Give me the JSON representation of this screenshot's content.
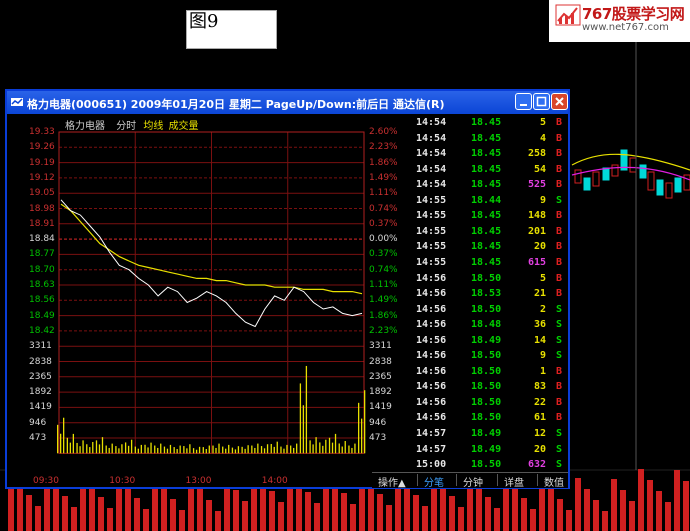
{
  "figure_label": "图9",
  "brand": {
    "name": "767股票学习网",
    "url": "www.net767.com"
  },
  "window": {
    "title": "格力电器(000651)  2009年01月20日  星期二  PageUp/Down:前后日  通达信(R)"
  },
  "quote": {
    "stock": "格力电器",
    "time_label": "分时",
    "avg_label": "均线",
    "vol_label": "成交量"
  },
  "left_ticks": [
    "19.33",
    "19.26",
    "19.19",
    "19.12",
    "19.05",
    "18.98",
    "18.91",
    "18.84",
    "18.77",
    "18.70",
    "18.63",
    "18.56",
    "18.49",
    "18.42",
    "3311",
    "2838",
    "2365",
    "1892",
    "1419",
    "946",
    "473"
  ],
  "right_ticks": [
    "2.60%",
    "2.23%",
    "1.86%",
    "1.49%",
    "1.11%",
    "0.74%",
    "0.37%",
    "0.00%",
    "0.37%",
    "0.74%",
    "1.11%",
    "1.49%",
    "1.86%",
    "2.23%",
    "3311",
    "2838",
    "2365",
    "1892",
    "1419",
    "946",
    "473"
  ],
  "x_ticks": [
    "09:30",
    "10:30",
    "13:00",
    "14:00"
  ],
  "trades": [
    {
      "time": "14:54",
      "price": "18.45",
      "vol": "5",
      "dir": "B"
    },
    {
      "time": "14:54",
      "price": "18.45",
      "vol": "4",
      "dir": "B"
    },
    {
      "time": "14:54",
      "price": "18.45",
      "vol": "258",
      "dir": "B"
    },
    {
      "time": "14:54",
      "price": "18.45",
      "vol": "54",
      "dir": "B"
    },
    {
      "time": "14:54",
      "price": "18.45",
      "vol": "525",
      "dir": "B"
    },
    {
      "time": "14:55",
      "price": "18.44",
      "vol": "9",
      "dir": "S"
    },
    {
      "time": "14:55",
      "price": "18.45",
      "vol": "148",
      "dir": "B"
    },
    {
      "time": "14:55",
      "price": "18.45",
      "vol": "201",
      "dir": "B"
    },
    {
      "time": "14:55",
      "price": "18.45",
      "vol": "20",
      "dir": "B"
    },
    {
      "time": "14:55",
      "price": "18.45",
      "vol": "615",
      "dir": "B"
    },
    {
      "time": "14:56",
      "price": "18.50",
      "vol": "5",
      "dir": "B"
    },
    {
      "time": "14:56",
      "price": "18.53",
      "vol": "21",
      "dir": "B"
    },
    {
      "time": "14:56",
      "price": "18.50",
      "vol": "2",
      "dir": "S"
    },
    {
      "time": "14:56",
      "price": "18.48",
      "vol": "36",
      "dir": "S"
    },
    {
      "time": "14:56",
      "price": "18.49",
      "vol": "14",
      "dir": "S"
    },
    {
      "time": "14:56",
      "price": "18.50",
      "vol": "9",
      "dir": "S"
    },
    {
      "time": "14:56",
      "price": "18.50",
      "vol": "1",
      "dir": "B"
    },
    {
      "time": "14:56",
      "price": "18.50",
      "vol": "83",
      "dir": "B"
    },
    {
      "time": "14:56",
      "price": "18.50",
      "vol": "22",
      "dir": "B"
    },
    {
      "time": "14:56",
      "price": "18.50",
      "vol": "61",
      "dir": "B"
    },
    {
      "time": "14:57",
      "price": "18.49",
      "vol": "12",
      "dir": "S"
    },
    {
      "time": "14:57",
      "price": "18.49",
      "vol": "20",
      "dir": "S"
    },
    {
      "time": "15:00",
      "price": "18.50",
      "vol": "632",
      "dir": "S"
    }
  ],
  "tabs": [
    "操作▲",
    "分笔",
    "分钟",
    "详盘",
    "数值"
  ],
  "colors": {
    "up": "#c93030",
    "down": "#00c000",
    "avg_line": "#e7e000",
    "price_line": "#ffffff",
    "title_bar": "#0b45d6"
  },
  "chart_data": {
    "type": "line",
    "title": "",
    "prev_close": 18.84,
    "ylim": [
      18.42,
      19.33
    ],
    "vol_ylim": [
      0,
      3311
    ],
    "xlabels": [
      "09:30",
      "10:30",
      "13:00",
      "14:00"
    ],
    "series": [
      {
        "name": "分时",
        "values": [
          19.02,
          18.97,
          18.95,
          18.9,
          18.85,
          18.78,
          18.72,
          18.7,
          18.66,
          18.63,
          18.58,
          18.62,
          18.6,
          18.55,
          18.57,
          18.6,
          18.58,
          18.55,
          18.5,
          18.46,
          18.44,
          18.52,
          18.58,
          18.56,
          18.62,
          18.6,
          18.55,
          18.52,
          18.53,
          18.5,
          18.49,
          18.5
        ]
      },
      {
        "name": "均线",
        "values": [
          19.0,
          18.97,
          18.92,
          18.87,
          18.82,
          18.79,
          18.76,
          18.74,
          18.72,
          18.71,
          18.7,
          18.69,
          18.68,
          18.67,
          18.66,
          18.66,
          18.65,
          18.65,
          18.64,
          18.63,
          18.63,
          18.63,
          18.62,
          18.62,
          18.62,
          18.61,
          18.61,
          18.61,
          18.6,
          18.6,
          18.6,
          18.59
        ]
      },
      {
        "name": "成交量",
        "values": [
          1100,
          600,
          400,
          350,
          500,
          300,
          280,
          420,
          260,
          330,
          300,
          260,
          240,
          280,
          200,
          240,
          300,
          260,
          220,
          250,
          300,
          280,
          360,
          260,
          300,
          2700,
          500,
          420,
          600,
          380,
          300,
          1950
        ]
      }
    ]
  }
}
